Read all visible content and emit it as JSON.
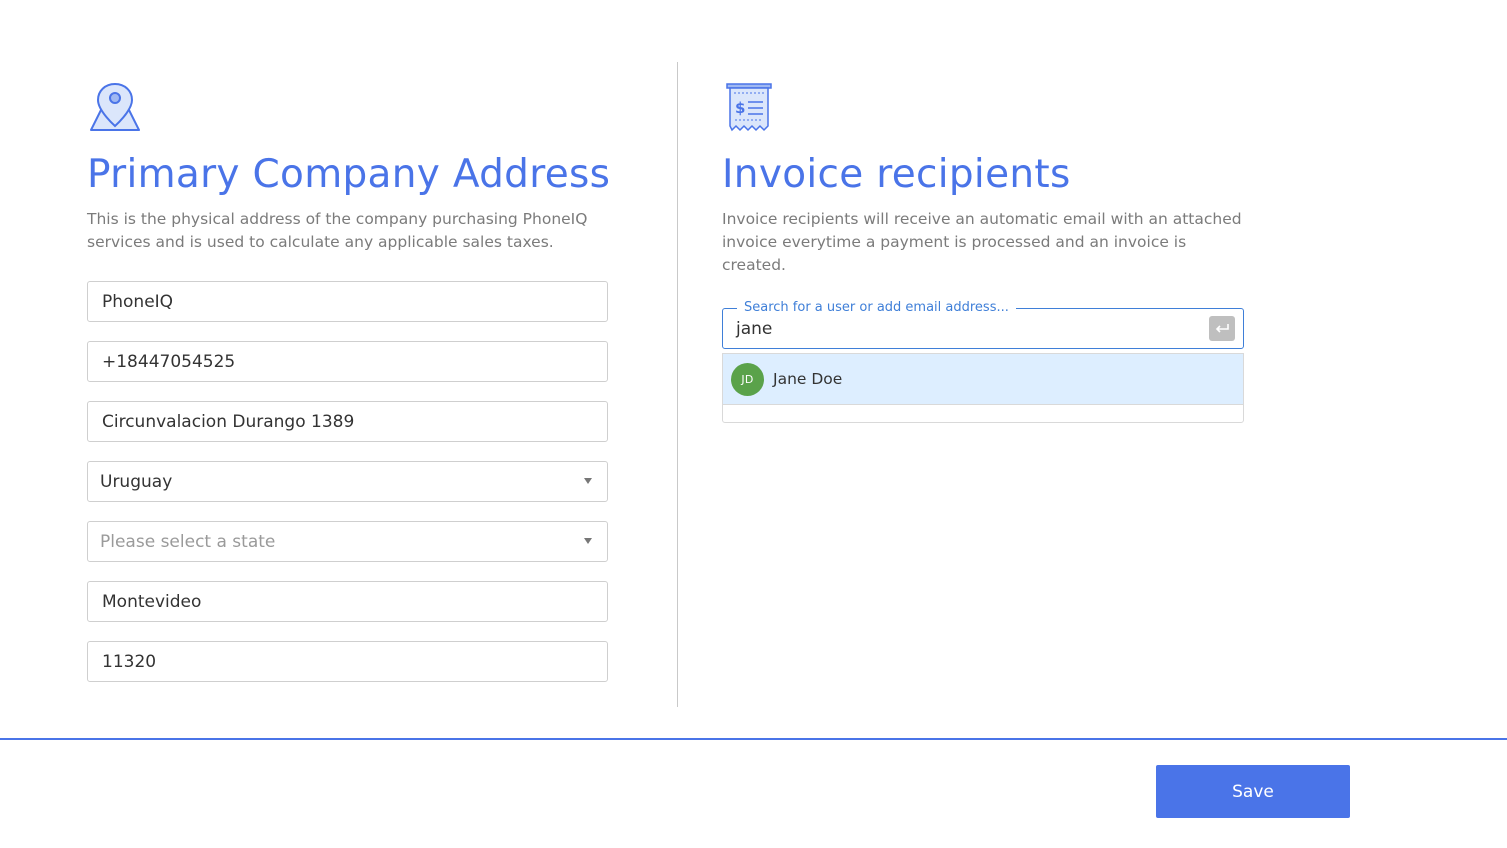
{
  "colors": {
    "accent": "#4a74e8",
    "focus_border": "#3f7fd8",
    "avatar_bg": "#5aa24a",
    "highlight_row": "#ddeeff"
  },
  "address": {
    "icon": "map-pin-icon",
    "title": "Primary Company Address",
    "description": "This is the physical address of the company purchasing PhoneIQ services and is used to calculate any applicable sales taxes.",
    "company_name": "PhoneIQ",
    "phone": "+18447054525",
    "street": "Circunvalacion Durango 1389",
    "country": "Uruguay",
    "state_placeholder": "Please select a state",
    "city": "Montevideo",
    "zip": "11320"
  },
  "invoice": {
    "icon": "receipt-icon",
    "title": "Invoice recipients",
    "description": "Invoice recipients will receive an automatic email with an attached invoice everytime a payment is processed and an invoice is created.",
    "search_label": "Search for a user or add email address...",
    "search_value": "jane",
    "enter_icon": "enter-key-icon",
    "results": [
      {
        "initials": "JD",
        "name": "Jane Doe"
      }
    ]
  },
  "footer": {
    "save_label": "Save"
  }
}
